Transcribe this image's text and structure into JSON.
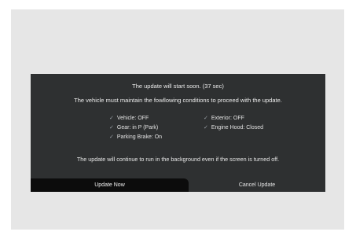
{
  "dialog": {
    "title": "The update will start soon. (37 sec)",
    "subtitle": "The vehicle must maintain the fowllowing conditions to proceed with the update.",
    "conditions": [
      {
        "check_icon": "checkmark-icon",
        "label": "Vehicle: OFF"
      },
      {
        "check_icon": "checkmark-icon",
        "label": "Gear: in P (Park)"
      },
      {
        "check_icon": "checkmark-icon",
        "label": "Parking Brake: On"
      },
      {
        "check_icon": "checkmark-icon",
        "label": "Exterior: OFF"
      },
      {
        "check_icon": "checkmark-icon",
        "label": "Engine Hood: Closed"
      }
    ],
    "note": "The update will continue to run in the background even if the screen is turned off.",
    "buttons": {
      "primary": "Update Now",
      "secondary": "Cancel Update"
    }
  },
  "colors": {
    "screen_background": "#e6e6e6",
    "dialog_background": "#2e3031",
    "primary_button": "#0c0c0c",
    "text": "#e9e9e9"
  }
}
